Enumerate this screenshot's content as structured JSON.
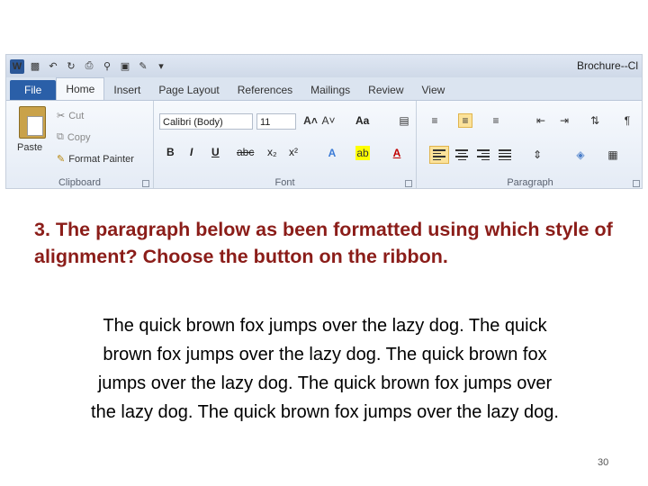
{
  "window": {
    "title": "Brochure--Cl"
  },
  "quick_access": {
    "logo_letter": "W"
  },
  "tabs": [
    "File",
    "Home",
    "Insert",
    "Page Layout",
    "References",
    "Mailings",
    "Review",
    "View"
  ],
  "clipboard": {
    "paste": "Paste",
    "cut": "Cut",
    "copy": "Copy",
    "format_painter": "Format Painter",
    "group_label": "Clipboard"
  },
  "font": {
    "name": "Calibri (Body)",
    "size": "11",
    "bold": "B",
    "italic": "I",
    "underline": "U",
    "strike": "abc",
    "subscript": "x₂",
    "superscript": "x²",
    "case": "Aa",
    "group_label": "Font"
  },
  "paragraph": {
    "group_label": "Paragraph",
    "pilcrow": "¶"
  },
  "question": {
    "text": "3. The paragraph below as been formatted using which style of  alignment? Choose the button on the ribbon."
  },
  "sample_paragraph": {
    "text": "The quick brown fox jumps over the lazy dog. The quick brown fox jumps over the lazy dog. The quick brown fox jumps over the lazy dog. The quick brown fox jumps over the lazy dog. The quick brown fox jumps over the lazy dog."
  },
  "page": {
    "number": "30"
  }
}
